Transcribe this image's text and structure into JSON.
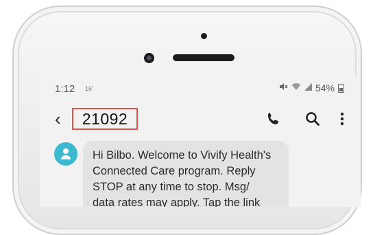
{
  "status_bar": {
    "time": "1:12",
    "badge": "16'",
    "battery": "54%"
  },
  "conversation": {
    "contact": "21092"
  },
  "message": {
    "lines": [
      "Hi Bilbo. Welcome to Vivify Health's",
      "Connected Care program. Reply",
      "STOP at any time to stop. Msg/",
      "data rates may apply. Tap the link"
    ]
  },
  "colors": {
    "highlight_border": "#d9534f",
    "avatar": "#3cb8cf",
    "bubble": "#e3e3e3"
  },
  "icons": [
    "back-arrow-icon",
    "phone-icon",
    "search-icon",
    "more-vert-icon",
    "person-icon",
    "mute-icon",
    "wifi-icon",
    "signal-icon",
    "battery-icon"
  ]
}
